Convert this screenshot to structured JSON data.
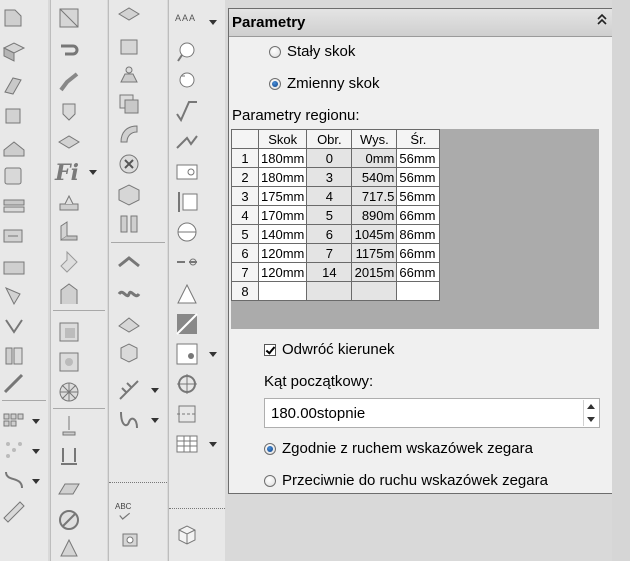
{
  "panel": {
    "title": "Parametry",
    "mode_options": [
      {
        "label": "Stały skok",
        "selected": false
      },
      {
        "label": "Zmienny skok",
        "selected": true
      }
    ],
    "region_label": "Parametry regionu:",
    "table": {
      "headers": [
        "Skok",
        "Obr.",
        "Wys.",
        "Śr."
      ],
      "rows": [
        {
          "n": "1",
          "skok": "180mm",
          "obr": "0",
          "wys": "0mm",
          "sr": "56mm"
        },
        {
          "n": "2",
          "skok": "180mm",
          "obr": "3",
          "wys": "540m",
          "sr": "56mm"
        },
        {
          "n": "3",
          "skok": "175mm",
          "obr": "4",
          "wys": "717.5",
          "sr": "56mm"
        },
        {
          "n": "4",
          "skok": "170mm",
          "obr": "5",
          "wys": "890m",
          "sr": "66mm"
        },
        {
          "n": "5",
          "skok": "140mm",
          "obr": "6",
          "wys": "1045m",
          "sr": "86mm"
        },
        {
          "n": "6",
          "skok": "120mm",
          "obr": "7",
          "wys": "1175m",
          "sr": "66mm"
        },
        {
          "n": "7",
          "skok": "120mm",
          "obr": "14",
          "wys": "2015m",
          "sr": "66mm"
        },
        {
          "n": "8",
          "skok": "",
          "obr": "",
          "wys": "",
          "sr": ""
        }
      ]
    },
    "reverse_label": "Odwróć kierunek",
    "reverse_checked": true,
    "start_angle_label": "Kąt początkowy:",
    "start_angle_value": "180.00stopnie",
    "direction_options": [
      {
        "label": "Zgodnie z ruchem wskazówek zegara",
        "selected": true
      },
      {
        "label": "Przeciwnie do ruchu wskazówek zegara",
        "selected": false
      }
    ]
  },
  "toolbar": {
    "fi_label": "Fi",
    "abc_label": "ABC",
    "text_aaa_label": "AAA"
  },
  "colors": {
    "panel_bg": "#f0f0f0",
    "grid_bg": "#ababab",
    "radio_on": "#0b3f86"
  }
}
